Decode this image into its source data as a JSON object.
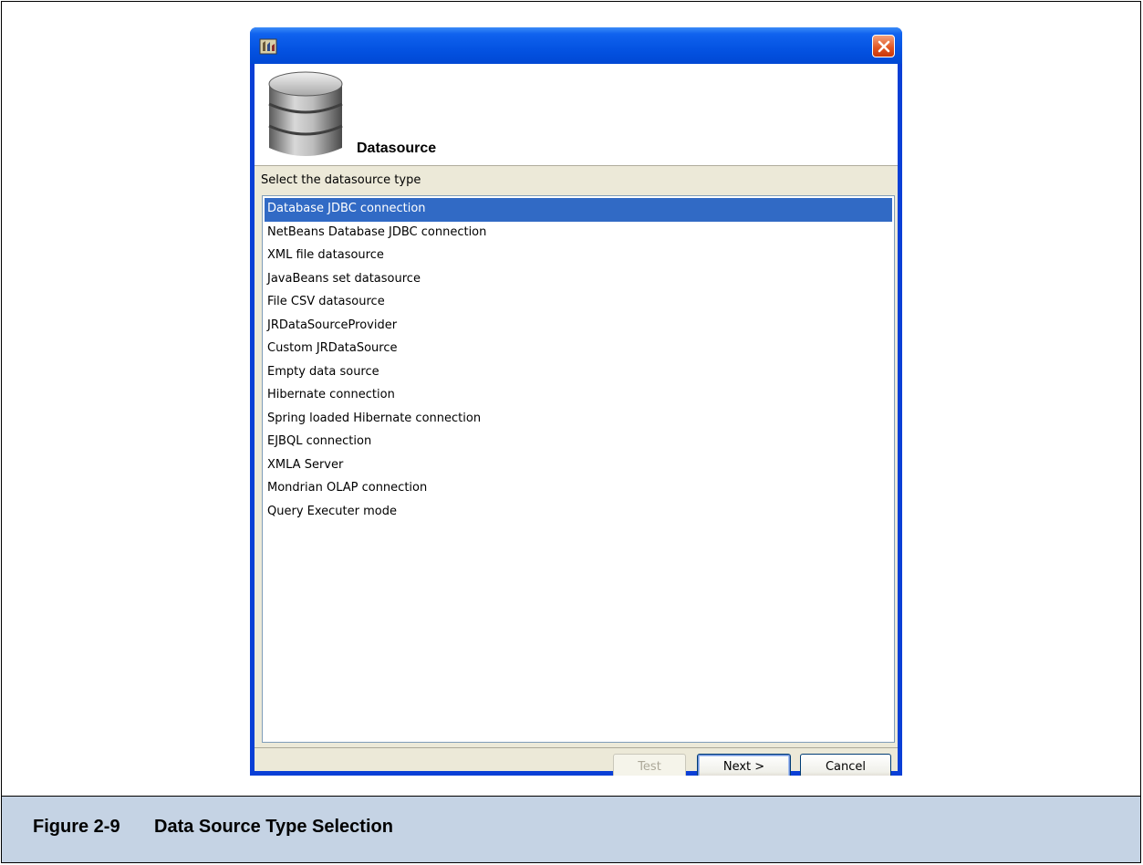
{
  "dialog": {
    "header_title": "Datasource",
    "prompt": "Select the datasource type"
  },
  "datasource_types": [
    {
      "label": "Database JDBC connection",
      "selected": true
    },
    {
      "label": "NetBeans Database JDBC connection",
      "selected": false
    },
    {
      "label": "XML file datasource",
      "selected": false
    },
    {
      "label": "JavaBeans set datasource",
      "selected": false
    },
    {
      "label": "File CSV datasource",
      "selected": false
    },
    {
      "label": "JRDataSourceProvider",
      "selected": false
    },
    {
      "label": "Custom JRDataSource",
      "selected": false
    },
    {
      "label": "Empty data source",
      "selected": false
    },
    {
      "label": "Hibernate connection",
      "selected": false
    },
    {
      "label": "Spring loaded Hibernate connection",
      "selected": false
    },
    {
      "label": "EJBQL connection",
      "selected": false
    },
    {
      "label": "XMLA Server",
      "selected": false
    },
    {
      "label": "Mondrian OLAP connection",
      "selected": false
    },
    {
      "label": "Query Executer mode",
      "selected": false
    }
  ],
  "buttons": {
    "test": "Test",
    "next": "Next >",
    "cancel": "Cancel"
  },
  "caption": {
    "number": "Figure 2-9",
    "text": "Data Source Type Selection"
  },
  "colors": {
    "selection": "#316ac5",
    "titlebar": "#0453e2",
    "caption_bg": "#c5d3e4"
  },
  "icons": {
    "app": "app-icon",
    "close": "close-icon",
    "header": "database-icon"
  }
}
